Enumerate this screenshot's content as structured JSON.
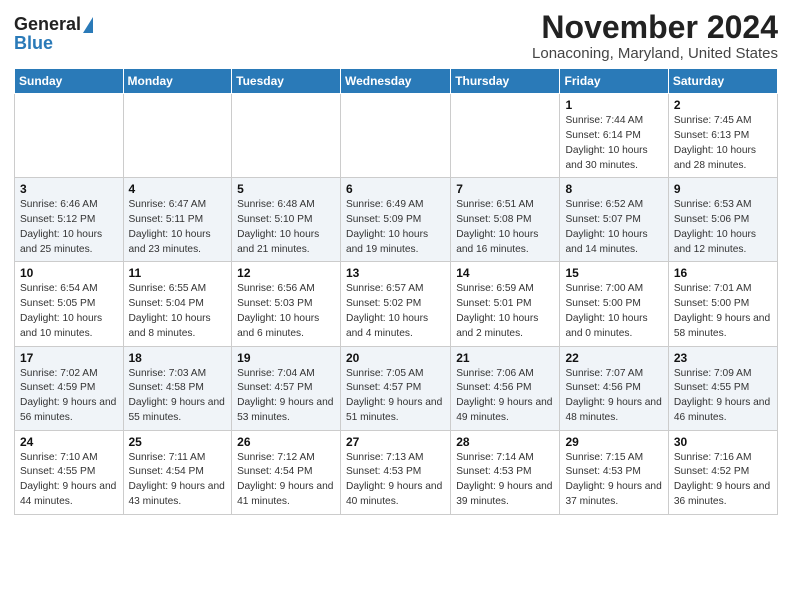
{
  "header": {
    "logo_line1": "General",
    "logo_line2": "Blue",
    "title": "November 2024",
    "subtitle": "Lonaconing, Maryland, United States"
  },
  "calendar": {
    "weekdays": [
      "Sunday",
      "Monday",
      "Tuesday",
      "Wednesday",
      "Thursday",
      "Friday",
      "Saturday"
    ],
    "weeks": [
      [
        {
          "day": "",
          "info": ""
        },
        {
          "day": "",
          "info": ""
        },
        {
          "day": "",
          "info": ""
        },
        {
          "day": "",
          "info": ""
        },
        {
          "day": "",
          "info": ""
        },
        {
          "day": "1",
          "info": "Sunrise: 7:44 AM\nSunset: 6:14 PM\nDaylight: 10 hours and 30 minutes."
        },
        {
          "day": "2",
          "info": "Sunrise: 7:45 AM\nSunset: 6:13 PM\nDaylight: 10 hours and 28 minutes."
        }
      ],
      [
        {
          "day": "3",
          "info": "Sunrise: 6:46 AM\nSunset: 5:12 PM\nDaylight: 10 hours and 25 minutes."
        },
        {
          "day": "4",
          "info": "Sunrise: 6:47 AM\nSunset: 5:11 PM\nDaylight: 10 hours and 23 minutes."
        },
        {
          "day": "5",
          "info": "Sunrise: 6:48 AM\nSunset: 5:10 PM\nDaylight: 10 hours and 21 minutes."
        },
        {
          "day": "6",
          "info": "Sunrise: 6:49 AM\nSunset: 5:09 PM\nDaylight: 10 hours and 19 minutes."
        },
        {
          "day": "7",
          "info": "Sunrise: 6:51 AM\nSunset: 5:08 PM\nDaylight: 10 hours and 16 minutes."
        },
        {
          "day": "8",
          "info": "Sunrise: 6:52 AM\nSunset: 5:07 PM\nDaylight: 10 hours and 14 minutes."
        },
        {
          "day": "9",
          "info": "Sunrise: 6:53 AM\nSunset: 5:06 PM\nDaylight: 10 hours and 12 minutes."
        }
      ],
      [
        {
          "day": "10",
          "info": "Sunrise: 6:54 AM\nSunset: 5:05 PM\nDaylight: 10 hours and 10 minutes."
        },
        {
          "day": "11",
          "info": "Sunrise: 6:55 AM\nSunset: 5:04 PM\nDaylight: 10 hours and 8 minutes."
        },
        {
          "day": "12",
          "info": "Sunrise: 6:56 AM\nSunset: 5:03 PM\nDaylight: 10 hours and 6 minutes."
        },
        {
          "day": "13",
          "info": "Sunrise: 6:57 AM\nSunset: 5:02 PM\nDaylight: 10 hours and 4 minutes."
        },
        {
          "day": "14",
          "info": "Sunrise: 6:59 AM\nSunset: 5:01 PM\nDaylight: 10 hours and 2 minutes."
        },
        {
          "day": "15",
          "info": "Sunrise: 7:00 AM\nSunset: 5:00 PM\nDaylight: 10 hours and 0 minutes."
        },
        {
          "day": "16",
          "info": "Sunrise: 7:01 AM\nSunset: 5:00 PM\nDaylight: 9 hours and 58 minutes."
        }
      ],
      [
        {
          "day": "17",
          "info": "Sunrise: 7:02 AM\nSunset: 4:59 PM\nDaylight: 9 hours and 56 minutes."
        },
        {
          "day": "18",
          "info": "Sunrise: 7:03 AM\nSunset: 4:58 PM\nDaylight: 9 hours and 55 minutes."
        },
        {
          "day": "19",
          "info": "Sunrise: 7:04 AM\nSunset: 4:57 PM\nDaylight: 9 hours and 53 minutes."
        },
        {
          "day": "20",
          "info": "Sunrise: 7:05 AM\nSunset: 4:57 PM\nDaylight: 9 hours and 51 minutes."
        },
        {
          "day": "21",
          "info": "Sunrise: 7:06 AM\nSunset: 4:56 PM\nDaylight: 9 hours and 49 minutes."
        },
        {
          "day": "22",
          "info": "Sunrise: 7:07 AM\nSunset: 4:56 PM\nDaylight: 9 hours and 48 minutes."
        },
        {
          "day": "23",
          "info": "Sunrise: 7:09 AM\nSunset: 4:55 PM\nDaylight: 9 hours and 46 minutes."
        }
      ],
      [
        {
          "day": "24",
          "info": "Sunrise: 7:10 AM\nSunset: 4:55 PM\nDaylight: 9 hours and 44 minutes."
        },
        {
          "day": "25",
          "info": "Sunrise: 7:11 AM\nSunset: 4:54 PM\nDaylight: 9 hours and 43 minutes."
        },
        {
          "day": "26",
          "info": "Sunrise: 7:12 AM\nSunset: 4:54 PM\nDaylight: 9 hours and 41 minutes."
        },
        {
          "day": "27",
          "info": "Sunrise: 7:13 AM\nSunset: 4:53 PM\nDaylight: 9 hours and 40 minutes."
        },
        {
          "day": "28",
          "info": "Sunrise: 7:14 AM\nSunset: 4:53 PM\nDaylight: 9 hours and 39 minutes."
        },
        {
          "day": "29",
          "info": "Sunrise: 7:15 AM\nSunset: 4:53 PM\nDaylight: 9 hours and 37 minutes."
        },
        {
          "day": "30",
          "info": "Sunrise: 7:16 AM\nSunset: 4:52 PM\nDaylight: 9 hours and 36 minutes."
        }
      ]
    ]
  }
}
